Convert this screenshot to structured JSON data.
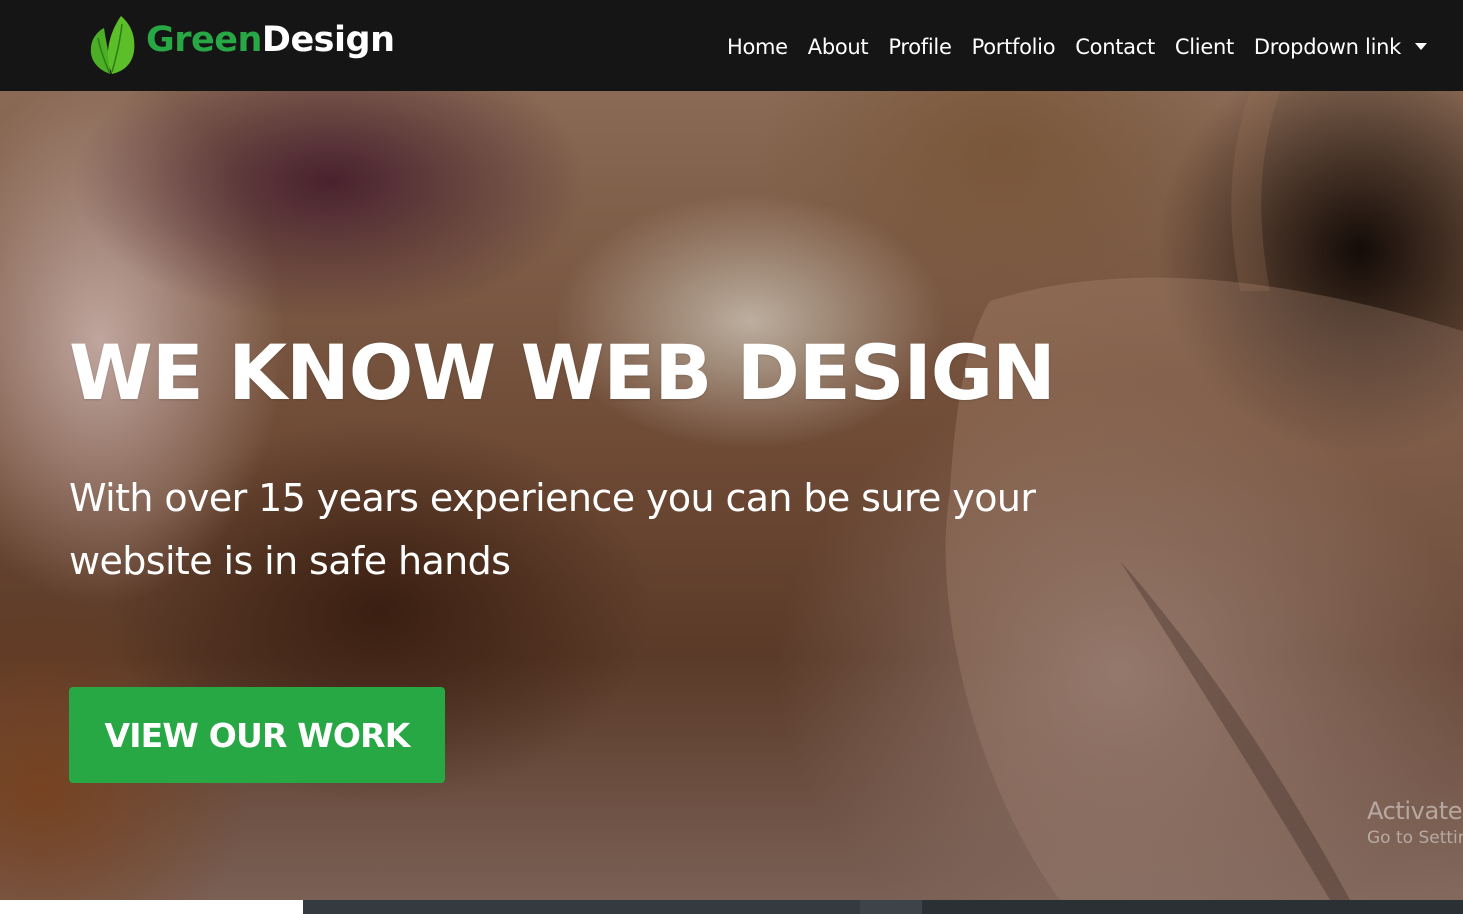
{
  "brand": {
    "name_part_green": "Green",
    "name_part_white": "Design",
    "logo_icon": "leaf-icon",
    "green_color": "#28a745"
  },
  "nav": {
    "items": [
      {
        "label": "Home"
      },
      {
        "label": "About"
      },
      {
        "label": "Profile"
      },
      {
        "label": "Portfolio"
      },
      {
        "label": "Contact"
      },
      {
        "label": "Client"
      }
    ],
    "dropdown": {
      "label": "Dropdown link",
      "icon": "caret-down-icon"
    }
  },
  "hero": {
    "title": "WE KNOW WEB DESIGN",
    "subtitle": "With over 15 years experience you can be sure your website is in safe hands",
    "button_label": "VIEW OUR WORK",
    "button_color": "#28a745"
  },
  "watermark": {
    "title": "Activate",
    "subtitle": "Go to Settin"
  }
}
